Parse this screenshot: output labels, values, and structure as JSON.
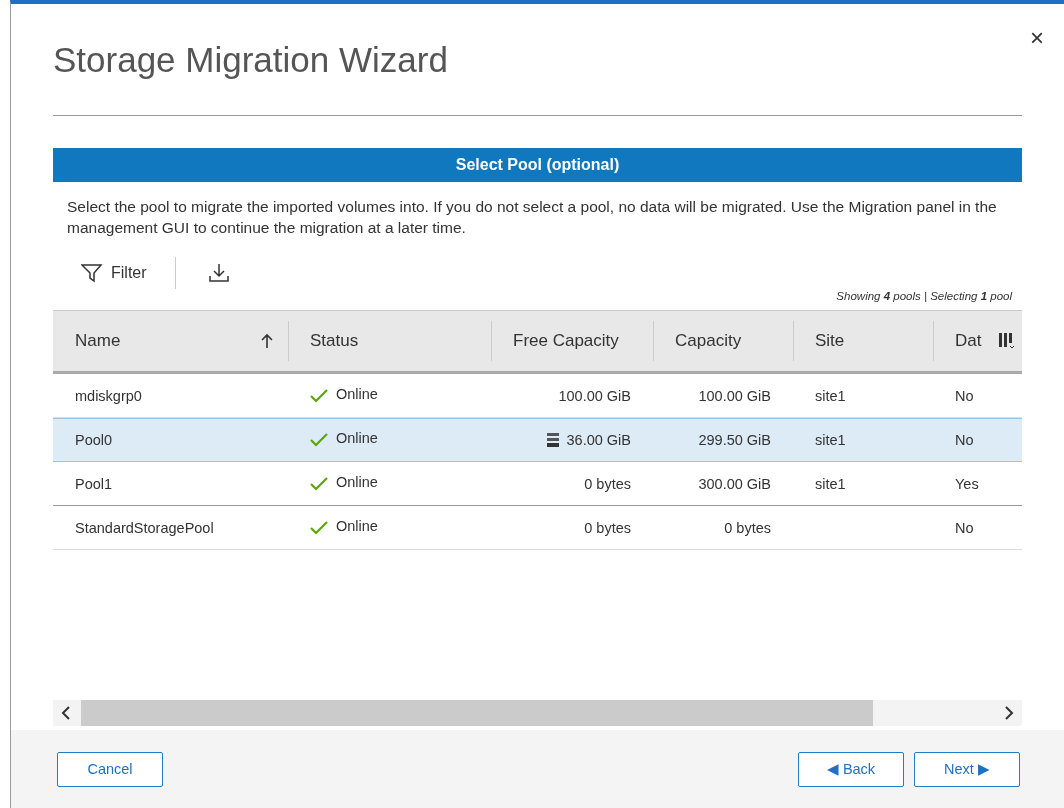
{
  "dialog": {
    "title": "Storage Migration Wizard",
    "close": "×"
  },
  "section": {
    "title": "Select Pool (optional)",
    "description": "Select the pool to migrate the imported volumes into. If you do not select a pool, no data will be migrated. Use the Migration panel in the management GUI to continue the migration at a later time."
  },
  "toolbar": {
    "filter": "Filter",
    "summary": "Showing **4** pools | Selecting **1** pool"
  },
  "table": {
    "columns": [
      {
        "label": "Name",
        "sorted": true
      },
      {
        "label": "Status",
        "sorted": false
      },
      {
        "label": "Free Capacity",
        "sorted": false
      },
      {
        "label": "Capacity",
        "sorted": false
      },
      {
        "label": "Site",
        "sorted": false
      },
      {
        "label": "Dat",
        "sorted": false
      }
    ],
    "rows": [
      {
        "selected": false,
        "capacity_icon": false,
        "cells": [
          "mdiskgrp0",
          "Online",
          "100.00 GiB",
          "100.00 GiB",
          "site1",
          "No"
        ]
      },
      {
        "selected": true,
        "capacity_icon": true,
        "cells": [
          "Pool0",
          "Online",
          "36.00 GiB",
          "299.50 GiB",
          "site1",
          "No"
        ]
      },
      {
        "selected": false,
        "capacity_icon": false,
        "cells": [
          "Pool1",
          "Online",
          "0 bytes",
          "300.00 GiB",
          "site1",
          "Yes"
        ]
      },
      {
        "selected": false,
        "capacity_icon": false,
        "cells": [
          "StandardStoragePool",
          "Online",
          "0 bytes",
          "0 bytes",
          "",
          "No"
        ]
      }
    ]
  },
  "footer": {
    "cancel": "Cancel",
    "back": "◀ Back",
    "next": "Next ▶"
  }
}
